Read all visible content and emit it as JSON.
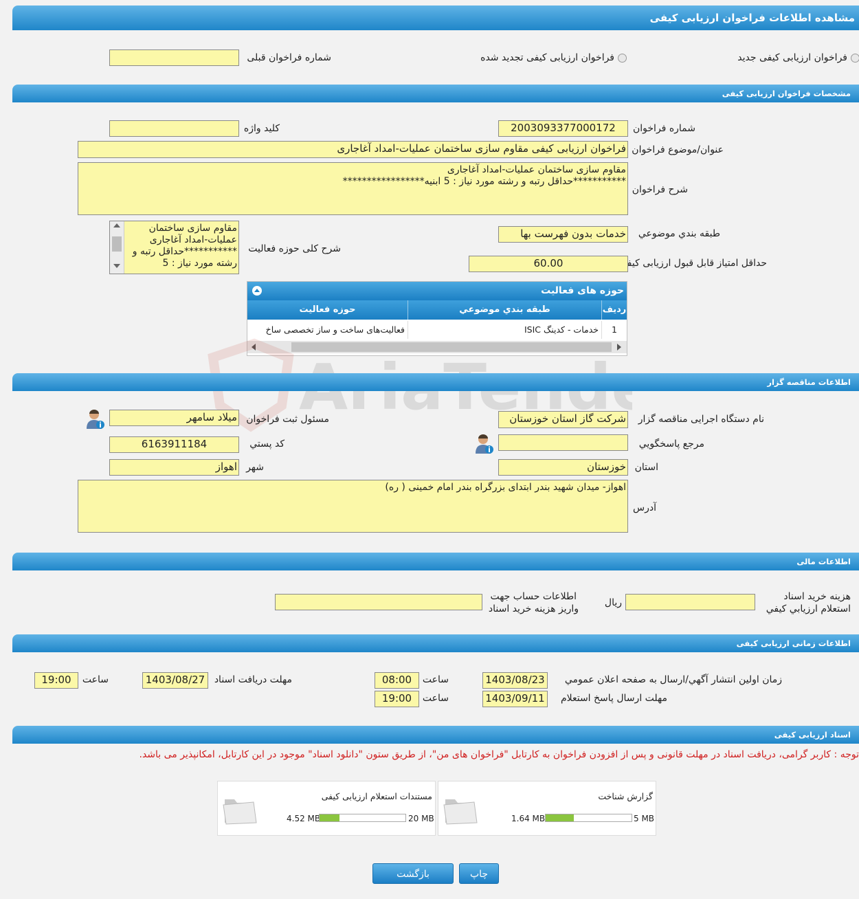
{
  "header": {
    "title": "مشاهده اطلاعات فراخوان ارزیابی کیفی"
  },
  "call_type": {
    "new_label": "فراخوان ارزیابی کیفی جدید",
    "renewed_label": "فراخوان ارزیابی کیفی تجدید شده",
    "previous_number_label": "شماره فراخوان قبلی",
    "previous_number_value": ""
  },
  "specs": {
    "section_title": "مشخصات فراخوان ارزیابی کیفی",
    "number_label": "شماره فراخوان",
    "number_value": "2003093377000172",
    "keyword_label": "کلید واژه",
    "keyword_value": "",
    "title_label": "عنوان/موضوع فراخوان",
    "title_value": "فراخوان ارزیابی کیفی مقاوم سازی ساختمان عملیات-امداد آغاجاری",
    "description_label": "شرح فراخوان",
    "description_value": "مقاوم سازی ساختمان عملیات-امداد آغاجاری\n***********حداقل رتبه و رشته مورد نیاز : 5 ابنیه*****************",
    "category_label": "طبقه بندي موضوعي",
    "category_value": "خدمات بدون فهرست بها",
    "activity_desc_label": "شرح کلی حوزه فعالیت",
    "activity_desc_value": "مقاوم سازی ساختمان عملیات-امداد آغاجاری ***********حداقل رتبه و رشته مورد نیاز : 5",
    "min_score_label": "حداقل امتیاز قابل قبول ارزیابی کیفی",
    "min_score_value": "60.00"
  },
  "activities": {
    "title": "حوزه های فعالیت",
    "columns": [
      "ردیف",
      "طبقه بندي موضوعي",
      "حوزه فعالیت"
    ],
    "rows": [
      {
        "row": "1",
        "category": "خدمات - کدینگ ISIC",
        "activity": "فعالیت‌های ساخت و ساز تخصصی ساخ"
      }
    ]
  },
  "organizer": {
    "section_title": "اطلاعات مناقصه گزار",
    "org_label": "نام دستگاه اجرایی مناقصه گزار",
    "org_value": "شرکت گاز استان خوزستان",
    "registrar_label": "مسئول ثبت فراخوان",
    "registrar_value": "میلاد سامهر",
    "responder_label": "مرجع پاسخگويي",
    "responder_value": "",
    "postal_label": "کد پستي",
    "postal_value": "6163911184",
    "province_label": "استان",
    "province_value": "خوزستان",
    "city_label": "شهر",
    "city_value": "اهواز",
    "address_label": "آدرس",
    "address_value": "اهواز- میدان شهید بندر ابتدای بزرگراه بندر امام خمینی ( ره)"
  },
  "financial": {
    "section_title": "اطلاعات مالی",
    "cost_label_1": "هزینه خرید اسناد",
    "cost_label_2": "استعلام ارزيابي کيفي",
    "cost_value": "",
    "currency": "ريال",
    "account_label_1": "اطلاعات حساب جهت",
    "account_label_2": "واریز هزینه خرید اسناد",
    "account_value": ""
  },
  "timing": {
    "section_title": "اطلاعات زمانی ارزیابی کیفی",
    "publish_label": "زمان اولین انتشار آگهي/ارسال به صفحه اعلان عمومي",
    "publish_date": "1403/08/23",
    "publish_time": "08:00",
    "receive_label": "مهلت دریافت اسناد",
    "receive_date": "1403/08/27",
    "receive_time": "19:00",
    "reply_label": "مهلت ارسال پاسخ استعلام",
    "reply_date": "1403/09/11",
    "reply_time": "19:00",
    "time_label": "ساعت"
  },
  "documents": {
    "section_title": "اسناد ارزیابی کیفی",
    "note": "توجه : کاربر گرامی، دریافت اسناد در مهلت قانونی و پس از افزودن فراخوان به کارتابل \"فراخوان های من\"، از طریق ستون \"دانلود اسناد\" موجود در این کارتابل، امکانپذیر می باشد.",
    "items": [
      {
        "title": "گزارش شناخت",
        "size": "1.64 MB",
        "max": "5 MB",
        "fraction": 0.33
      },
      {
        "title": "مستندات استعلام ارزیابی کیفی",
        "size": "4.52 MB",
        "max": "20 MB",
        "fraction": 0.23
      }
    ]
  },
  "buttons": {
    "print": "چاپ",
    "back": "بازگشت"
  },
  "colors": {
    "field_bg": "#fbf8a8",
    "header_blue": "#1f86c9",
    "progress_green": "#8bc53f",
    "note_red": "#d02020"
  }
}
